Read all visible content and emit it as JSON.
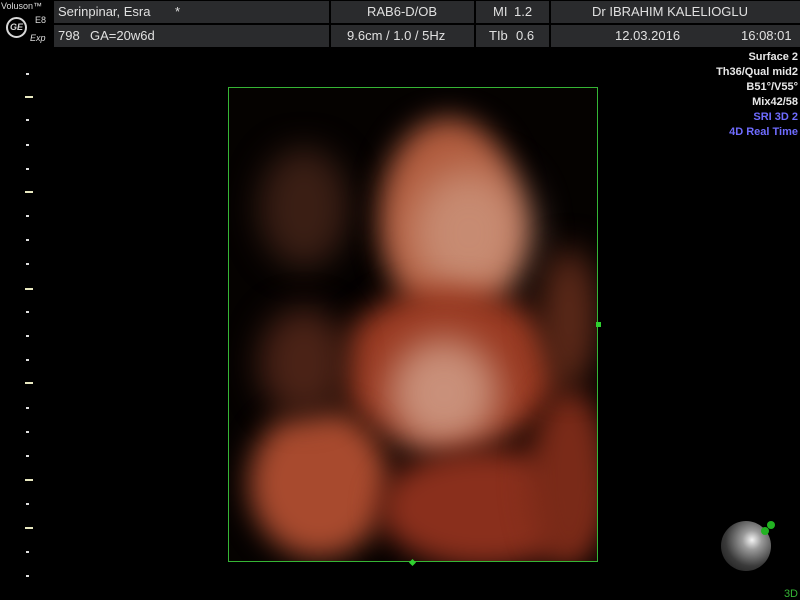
{
  "logo": {
    "brand": "Voluson™",
    "model": "E8",
    "sub": "Exp",
    "mark": "GE"
  },
  "header": {
    "patient": "Serinpinar, Esra",
    "patient_flag": "*",
    "exam_id": "798",
    "gestational_age": "GA=20w6d",
    "probe": "RAB6-D/OB",
    "mi": "MI",
    "mi_value": "1.2",
    "doctor": "Dr IBRAHIM KALELIOGLU",
    "depth": "9.6cm / 1.0 /  5Hz",
    "tib": "TIb",
    "tib_value": "0.6",
    "date": "12.03.2016",
    "time": "16:08:01"
  },
  "params": [
    {
      "text": "Surface 2",
      "color": "white"
    },
    {
      "text": "Th36/Qual mid2",
      "color": "white"
    },
    {
      "text": "B51°/V55°",
      "color": "white"
    },
    {
      "text": "Mix42/58",
      "color": "white"
    },
    {
      "text": "SRI 3D 2",
      "color": "blue"
    },
    {
      "text": "4D Real Time",
      "color": "blue"
    }
  ],
  "orientation": {
    "label": "3D"
  }
}
